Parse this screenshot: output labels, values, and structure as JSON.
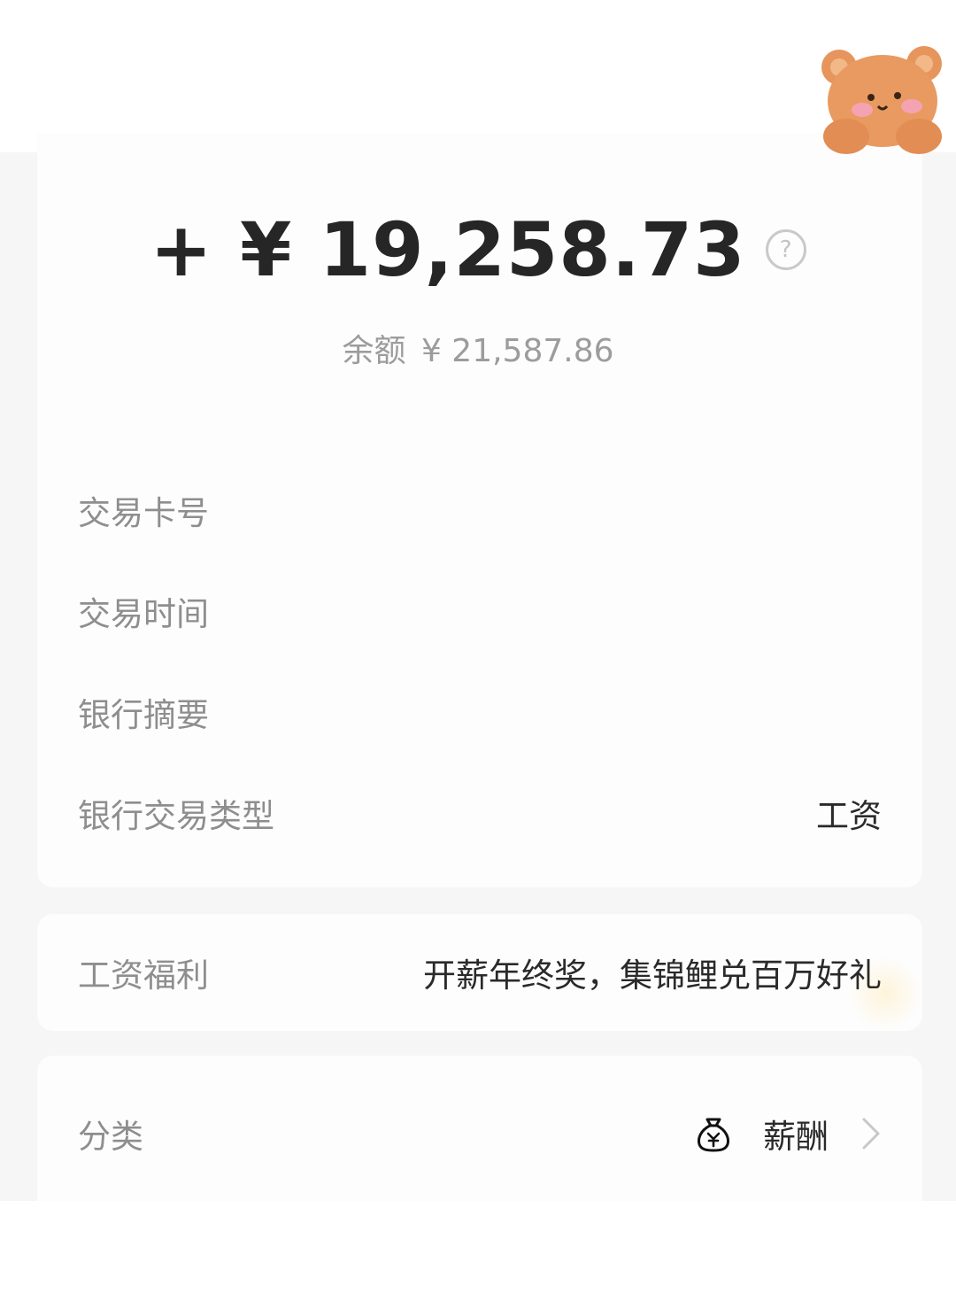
{
  "amount": {
    "value": "+ ¥ 19,258.73",
    "help_icon": "question-circle-icon"
  },
  "balance": {
    "label": "余额",
    "value": "¥ 21,587.86"
  },
  "details": [
    {
      "label": "交易卡号",
      "value": ""
    },
    {
      "label": "交易时间",
      "value": ""
    },
    {
      "label": "银行摘要",
      "value": ""
    },
    {
      "label": "银行交易类型",
      "value": "工资"
    }
  ],
  "benefit": {
    "label": "工资福利",
    "value": "开薪年终奖，集锦鲤兑百万好礼"
  },
  "category": {
    "label": "分类",
    "icon": "money-bag-icon",
    "value": "薪酬",
    "chevron": "chevron-right-icon"
  },
  "decoration": {
    "sticker": "bear-sticker"
  },
  "colors": {
    "amount": "#262626",
    "label": "#8e8e8e",
    "value": "#2a2a2a",
    "background": "#f6f6f6"
  }
}
